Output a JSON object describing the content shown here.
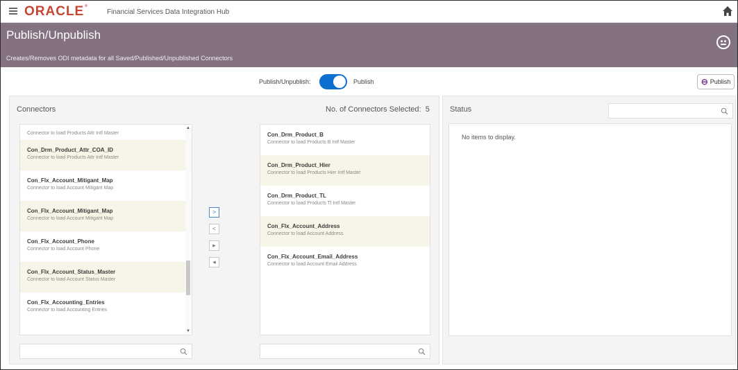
{
  "app": {
    "logo": "ORACLE",
    "logo_mark": "®",
    "product": "Financial Services Data Integration Hub"
  },
  "header": {
    "title": "Publish/Unpublish",
    "subtitle": "Creates/Removes ODI metadata for all Saved/Published/Unpublished Connectors"
  },
  "toolbar": {
    "toggle_label": "Publish/Unpublish:",
    "toggle_state": "Publish",
    "toggle_on": true,
    "publish_button": "Publish"
  },
  "connectors": {
    "title": "Connectors",
    "selected_label": "No. of Connectors Selected:",
    "selected_count": "5",
    "available": [
      {
        "name": "",
        "desc": "Connector to load Products Attr Intf Master",
        "partial": true
      },
      {
        "name": "Con_Drm_Product_Attr_COA_ID",
        "desc": "Connector to load Products Attr Intf Master"
      },
      {
        "name": "Con_Flx_Account_Mitigant_Map",
        "desc": "Connector to load Account Mitigant Map"
      },
      {
        "name": "Con_Flx_Account_Mitigant_Map",
        "desc": "Connector to load Account Mitigant Map"
      },
      {
        "name": "Con_Flx_Account_Phone",
        "desc": "Connector to load Account Phone"
      },
      {
        "name": "Con_Flx_Account_Status_Master",
        "desc": "Connector to load Account Status Master"
      },
      {
        "name": "Con_Flx_Accounting_Entries",
        "desc": "Connector to load Accounting Entries"
      }
    ],
    "selected": [
      {
        "name": "Con_Drm_Product_B",
        "desc": "Connector to load Products B Intf Master"
      },
      {
        "name": "Con_Drm_Product_Hier",
        "desc": "Connector to load Products Hier Intf Master"
      },
      {
        "name": "Con_Drm_Product_TL",
        "desc": "Connector to load Products Tl Intf Master"
      },
      {
        "name": "Con_Flx_Account_Address",
        "desc": "Connector to load Account Address"
      },
      {
        "name": "Con_Flx_Account_Email_Address",
        "desc": "Connector to load Account Email Address"
      }
    ],
    "move_buttons": [
      ">",
      "<",
      "▸",
      "◂"
    ],
    "available_search_placeholder": "",
    "selected_search_placeholder": ""
  },
  "status": {
    "title": "Status",
    "empty_message": "No items to display.",
    "search_placeholder": ""
  },
  "colors": {
    "brand_red": "#c74634",
    "header_band": "#847181",
    "toggle_blue": "#0a6fcf",
    "alt_row": "#f7f5e7"
  }
}
